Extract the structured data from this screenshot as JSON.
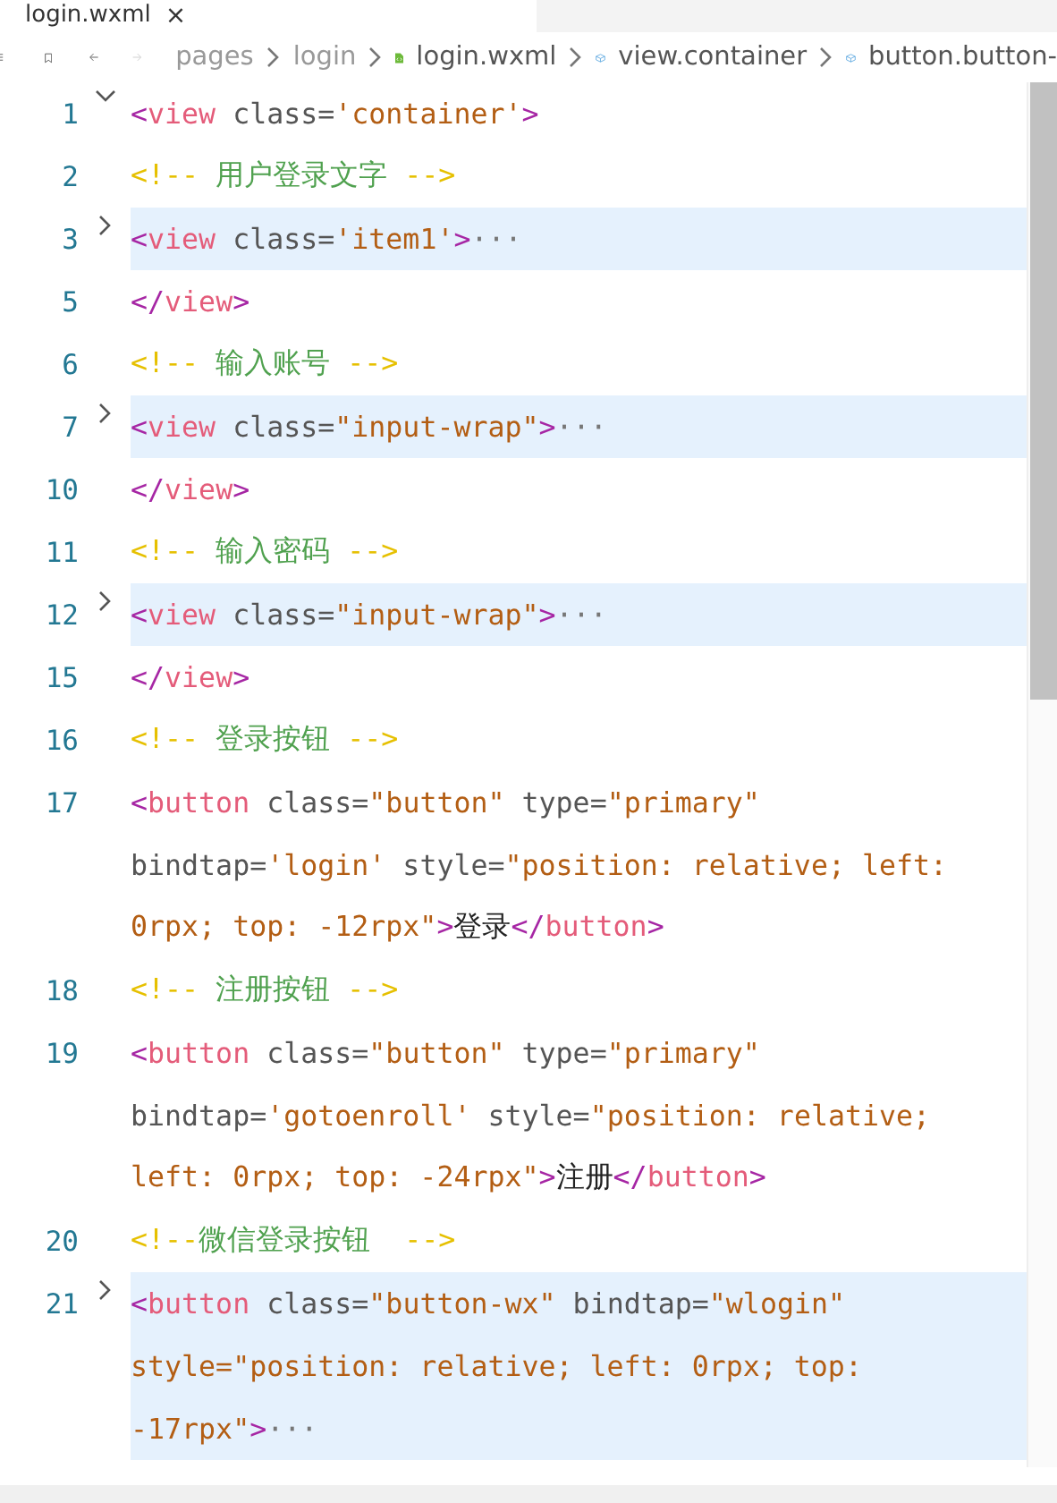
{
  "tab": {
    "title": "login.wxml",
    "close": "×"
  },
  "breadcrumb": {
    "items": [
      {
        "label": "pages",
        "kind": "folder"
      },
      {
        "label": "login",
        "kind": "folder"
      },
      {
        "label": "login.wxml",
        "kind": "file"
      },
      {
        "label": "view.container",
        "kind": "node"
      },
      {
        "label": "button.button-",
        "kind": "node"
      }
    ]
  },
  "lines": [
    {
      "number": "1",
      "collapsed": false,
      "highlighted": false,
      "rows": [
        {
          "parts": [
            {
              "kind": "bracket",
              "text": "<"
            },
            {
              "kind": "tag",
              "text": "view"
            },
            {
              "kind": "attr",
              "text": " class="
            },
            {
              "kind": "string",
              "text": "'container'"
            },
            {
              "kind": "bracket",
              "text": ">"
            }
          ]
        }
      ]
    },
    {
      "number": "2",
      "highlighted": false,
      "rows": [
        {
          "parts": [
            {
              "kind": "comment-mark",
              "text": "<!-- "
            },
            {
              "kind": "comment-text",
              "text": "用户登录文字"
            },
            {
              "kind": "comment-mark",
              "text": " -->"
            }
          ]
        }
      ]
    },
    {
      "number": "3",
      "collapsed": true,
      "highlighted": true,
      "rows": [
        {
          "parts": [
            {
              "kind": "bracket",
              "text": "<"
            },
            {
              "kind": "tag",
              "text": "view"
            },
            {
              "kind": "attr",
              "text": " class="
            },
            {
              "kind": "string",
              "text": "'item1'"
            },
            {
              "kind": "bracket",
              "text": ">"
            },
            {
              "kind": "ellipsis",
              "text": "···"
            }
          ]
        }
      ]
    },
    {
      "number": "5",
      "highlighted": false,
      "rows": [
        {
          "parts": [
            {
              "kind": "bracket",
              "text": "</"
            },
            {
              "kind": "tag",
              "text": "view"
            },
            {
              "kind": "bracket",
              "text": ">"
            }
          ]
        }
      ]
    },
    {
      "number": "6",
      "highlighted": false,
      "rows": [
        {
          "parts": [
            {
              "kind": "comment-mark",
              "text": "<!-- "
            },
            {
              "kind": "comment-text",
              "text": "输入账号"
            },
            {
              "kind": "comment-mark",
              "text": " -->"
            }
          ]
        }
      ]
    },
    {
      "number": "7",
      "collapsed": true,
      "highlighted": true,
      "rows": [
        {
          "parts": [
            {
              "kind": "bracket",
              "text": "<"
            },
            {
              "kind": "tag",
              "text": "view"
            },
            {
              "kind": "attr",
              "text": " class="
            },
            {
              "kind": "string",
              "text": "\"input-wrap\""
            },
            {
              "kind": "bracket",
              "text": ">"
            },
            {
              "kind": "ellipsis",
              "text": "···"
            }
          ]
        }
      ]
    },
    {
      "number": "10",
      "highlighted": false,
      "rows": [
        {
          "parts": [
            {
              "kind": "bracket",
              "text": "</"
            },
            {
              "kind": "tag",
              "text": "view"
            },
            {
              "kind": "bracket",
              "text": ">"
            }
          ]
        }
      ]
    },
    {
      "number": "11",
      "highlighted": false,
      "rows": [
        {
          "parts": [
            {
              "kind": "comment-mark",
              "text": "<!-- "
            },
            {
              "kind": "comment-text",
              "text": "输入密码"
            },
            {
              "kind": "comment-mark",
              "text": " -->"
            }
          ]
        }
      ]
    },
    {
      "number": "12",
      "collapsed": true,
      "highlighted": true,
      "rows": [
        {
          "parts": [
            {
              "kind": "bracket",
              "text": "<"
            },
            {
              "kind": "tag",
              "text": "view"
            },
            {
              "kind": "attr",
              "text": " class="
            },
            {
              "kind": "string",
              "text": "\"input-wrap\""
            },
            {
              "kind": "bracket",
              "text": ">"
            },
            {
              "kind": "ellipsis",
              "text": "···"
            }
          ]
        }
      ]
    },
    {
      "number": "15",
      "highlighted": false,
      "rows": [
        {
          "parts": [
            {
              "kind": "bracket",
              "text": "</"
            },
            {
              "kind": "tag",
              "text": "view"
            },
            {
              "kind": "bracket",
              "text": ">"
            }
          ]
        }
      ]
    },
    {
      "number": "16",
      "highlighted": false,
      "rows": [
        {
          "parts": [
            {
              "kind": "comment-mark",
              "text": "<!-- "
            },
            {
              "kind": "comment-text",
              "text": "登录按钮"
            },
            {
              "kind": "comment-mark",
              "text": " -->"
            }
          ]
        }
      ]
    },
    {
      "number": "17",
      "highlighted": false,
      "rows": [
        {
          "parts": [
            {
              "kind": "bracket",
              "text": "<"
            },
            {
              "kind": "tag",
              "text": "button"
            },
            {
              "kind": "attr",
              "text": " class="
            },
            {
              "kind": "string",
              "text": "\"button\""
            },
            {
              "kind": "attr",
              "text": " type="
            },
            {
              "kind": "string",
              "text": "\"primary\""
            }
          ]
        },
        {
          "parts": [
            {
              "kind": "attr",
              "text": "bindtap="
            },
            {
              "kind": "string",
              "text": "'login'"
            },
            {
              "kind": "attr",
              "text": " style="
            },
            {
              "kind": "string",
              "text": "\"position: relative; left:"
            }
          ]
        },
        {
          "parts": [
            {
              "kind": "string",
              "text": "0rpx; top: -12rpx\""
            },
            {
              "kind": "bracket",
              "text": ">"
            },
            {
              "kind": "text",
              "text": "登录"
            },
            {
              "kind": "bracket",
              "text": "</"
            },
            {
              "kind": "tag",
              "text": "button"
            },
            {
              "kind": "bracket",
              "text": ">"
            }
          ]
        }
      ]
    },
    {
      "number": "18",
      "highlighted": false,
      "rows": [
        {
          "parts": [
            {
              "kind": "comment-mark",
              "text": "<!-- "
            },
            {
              "kind": "comment-text",
              "text": "注册按钮"
            },
            {
              "kind": "comment-mark",
              "text": " -->"
            }
          ]
        }
      ]
    },
    {
      "number": "19",
      "highlighted": false,
      "rows": [
        {
          "parts": [
            {
              "kind": "bracket",
              "text": "<"
            },
            {
              "kind": "tag",
              "text": "button"
            },
            {
              "kind": "attr",
              "text": " class="
            },
            {
              "kind": "string",
              "text": "\"button\""
            },
            {
              "kind": "attr",
              "text": " type="
            },
            {
              "kind": "string",
              "text": "\"primary\""
            }
          ]
        },
        {
          "parts": [
            {
              "kind": "attr",
              "text": "bindtap="
            },
            {
              "kind": "string",
              "text": "'gotoenroll'"
            },
            {
              "kind": "attr",
              "text": " style="
            },
            {
              "kind": "string",
              "text": "\"position: relative;"
            }
          ]
        },
        {
          "parts": [
            {
              "kind": "string",
              "text": "left: 0rpx; top: -24rpx\""
            },
            {
              "kind": "bracket",
              "text": ">"
            },
            {
              "kind": "text",
              "text": "注册"
            },
            {
              "kind": "bracket",
              "text": "</"
            },
            {
              "kind": "tag",
              "text": "button"
            },
            {
              "kind": "bracket",
              "text": ">"
            }
          ]
        }
      ]
    },
    {
      "number": "20",
      "highlighted": false,
      "rows": [
        {
          "parts": [
            {
              "kind": "comment-mark",
              "text": "<!--"
            },
            {
              "kind": "comment-text",
              "text": "微信登录按钮 "
            },
            {
              "kind": "comment-mark",
              "text": " -->"
            }
          ]
        }
      ]
    },
    {
      "number": "21",
      "collapsed": true,
      "highlighted": true,
      "rows": [
        {
          "parts": [
            {
              "kind": "bracket",
              "text": "<"
            },
            {
              "kind": "tag",
              "text": "button"
            },
            {
              "kind": "attr",
              "text": " class="
            },
            {
              "kind": "string",
              "text": "\"button-wx\""
            },
            {
              "kind": "attr",
              "text": " bindtap="
            },
            {
              "kind": "string",
              "text": "\"wlogin\""
            }
          ]
        },
        {
          "parts": [
            {
              "kind": "string",
              "text": "style=\"position: relative; left: 0rpx; top:"
            }
          ]
        },
        {
          "parts": [
            {
              "kind": "string",
              "text": "-17rpx\""
            },
            {
              "kind": "bracket",
              "text": ">"
            },
            {
              "kind": "ellipsis",
              "text": "···"
            }
          ]
        }
      ]
    }
  ]
}
